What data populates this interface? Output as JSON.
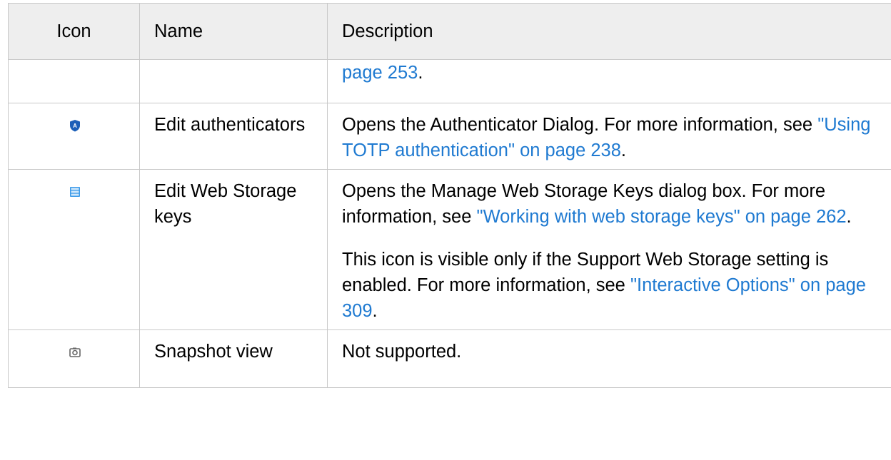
{
  "table": {
    "headers": {
      "icon": "Icon",
      "name": "Name",
      "description": "Description"
    },
    "continued_row": {
      "link": "page 253",
      "tail": "."
    },
    "authenticators": {
      "icon": "shield-a-icon",
      "name": "Edit authenticators",
      "desc_text": "Opens the Authenticator Dialog. For more information, see ",
      "link": "\"Using TOTP authentication\" on page 238",
      "tail": "."
    },
    "web_storage": {
      "icon": "storage-list-icon",
      "name": "Edit Web Storage keys",
      "desc1_text": "Opens the Manage Web Storage Keys dialog box. For more information, see ",
      "desc1_link": "\"Working with web storage keys\" on page 262",
      "desc1_tail": ".",
      "desc2_pre": "This icon is visible only if the ",
      "desc2_bold": "Support Web Storage",
      "desc2_mid": " setting is enabled. For more information, see ",
      "desc2_link": "\"Interactive Options\" on page 309",
      "desc2_tail": "."
    },
    "snapshot": {
      "icon": "camera-icon",
      "name": "Snapshot view",
      "description": "Not supported."
    }
  },
  "colors": {
    "link": "#1f7ad1",
    "header_bg": "#eeeeee",
    "border": "#c8c8c8",
    "shield": "#1c5fb8",
    "storage": "#3d9be9",
    "camera": "#666666"
  }
}
